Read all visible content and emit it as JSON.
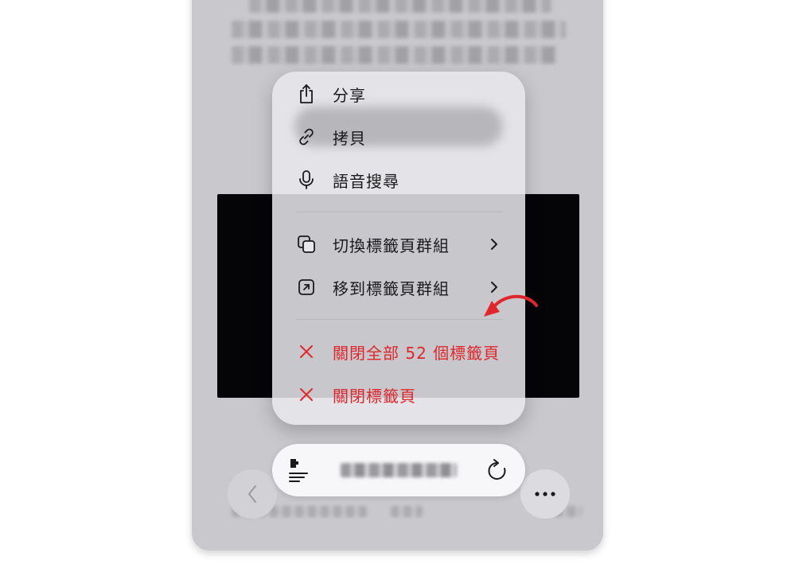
{
  "menu": {
    "items": [
      {
        "label": "分享",
        "icon": "share-icon"
      },
      {
        "label": "拷貝",
        "icon": "link-icon"
      },
      {
        "label": "語音搜尋",
        "icon": "microphone-icon"
      },
      {
        "label": "切換標籤頁群組",
        "icon": "tab-group-switch-icon"
      },
      {
        "label": "移到標籤頁群組",
        "icon": "move-to-group-icon"
      },
      {
        "label": "關閉全部 52 個標籤頁",
        "icon": "close-icon"
      },
      {
        "label": "關閉標籤頁",
        "icon": "close-icon"
      }
    ]
  },
  "colors": {
    "destructive": "#e0262a",
    "annotation_arrow": "#e0262a",
    "text": "#1a1a1a"
  }
}
